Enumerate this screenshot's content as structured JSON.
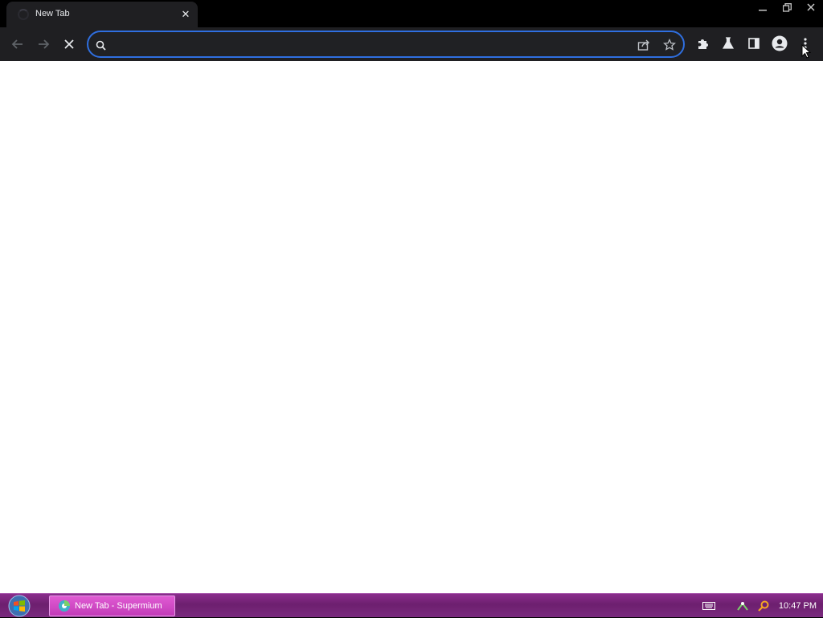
{
  "tab": {
    "title": "New Tab",
    "close_symbol": "✕"
  },
  "omnibox": {
    "value": "",
    "placeholder": ""
  },
  "window_controls": [
    "minimize",
    "restore",
    "close"
  ],
  "taskbar": {
    "task_label": "New Tab - Supermium",
    "clock": "10:47 PM"
  },
  "colors": {
    "accent": "#2f6fe0",
    "toolbar": "#1f1f22",
    "taskbar": "#7a2a7e"
  }
}
